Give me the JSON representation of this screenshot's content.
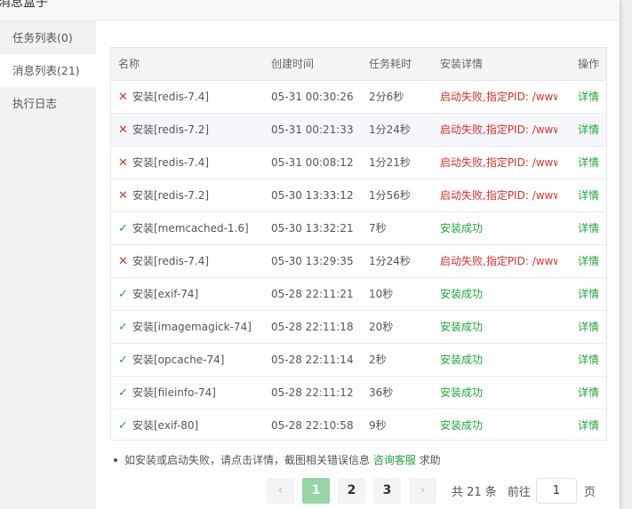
{
  "dialog": {
    "title": "消息盒子"
  },
  "sidebar": {
    "items": [
      {
        "label": "任务列表(0)"
      },
      {
        "label": "消息列表(21)"
      },
      {
        "label": "执行日志"
      }
    ]
  },
  "table": {
    "headers": {
      "name": "名称",
      "time": "创建时间",
      "duration": "任务耗时",
      "detail": "安装详情",
      "op": "操作"
    },
    "rows": [
      {
        "status": "fail",
        "name": "安装[redis-7.4]",
        "time": "05-31 00:30:26",
        "duration": "2分6秒",
        "detail": "启动失败,指定PID: /www",
        "op": "详情"
      },
      {
        "status": "fail",
        "name": "安装[redis-7.2]",
        "time": "05-31 00:21:33",
        "duration": "1分24秒",
        "detail": "启动失败,指定PID: /www",
        "op": "详情"
      },
      {
        "status": "fail",
        "name": "安装[redis-7.4]",
        "time": "05-31 00:08:12",
        "duration": "1分21秒",
        "detail": "启动失败,指定PID: /www",
        "op": "详情"
      },
      {
        "status": "fail",
        "name": "安装[redis-7.2]",
        "time": "05-30 13:33:12",
        "duration": "1分56秒",
        "detail": "启动失败,指定PID: /www",
        "op": "详情"
      },
      {
        "status": "ok",
        "name": "安装[memcached-1.6]",
        "time": "05-30 13:32:21",
        "duration": "7秒",
        "detail": "安装成功",
        "op": "详情"
      },
      {
        "status": "fail",
        "name": "安装[redis-7.4]",
        "time": "05-30 13:29:35",
        "duration": "1分24秒",
        "detail": "启动失败,指定PID: /www",
        "op": "详情"
      },
      {
        "status": "ok",
        "name": "安装[exif-74]",
        "time": "05-28 22:11:21",
        "duration": "10秒",
        "detail": "安装成功",
        "op": "详情"
      },
      {
        "status": "ok",
        "name": "安装[imagemagick-74]",
        "time": "05-28 22:11:18",
        "duration": "20秒",
        "detail": "安装成功",
        "op": "详情"
      },
      {
        "status": "ok",
        "name": "安装[opcache-74]",
        "time": "05-28 22:11:14",
        "duration": "2秒",
        "detail": "安装成功",
        "op": "详情"
      },
      {
        "status": "ok",
        "name": "安装[fileinfo-74]",
        "time": "05-28 22:11:12",
        "duration": "36秒",
        "detail": "安装成功",
        "op": "详情"
      },
      {
        "status": "ok",
        "name": "安装[exif-80]",
        "time": "05-28 22:10:58",
        "duration": "9秒",
        "detail": "安装成功",
        "op": "详情"
      }
    ]
  },
  "note": {
    "text": "如安装或启动失败，请点击详情，截图相关错误信息 ",
    "link": "咨询客服",
    "suffix": " 求助"
  },
  "pager": {
    "pages": [
      "1",
      "2",
      "3"
    ],
    "active": "1",
    "total": "共 21 条",
    "goto": "前往",
    "current": "1",
    "unit": "页"
  },
  "colors": {
    "success": "#20a53a",
    "danger": "#d9302c",
    "active_page": "#97d6a4"
  },
  "icons": {
    "fail": "close-icon",
    "ok": "check-icon",
    "prev": "chevron-left-icon",
    "next": "chevron-right-icon"
  }
}
